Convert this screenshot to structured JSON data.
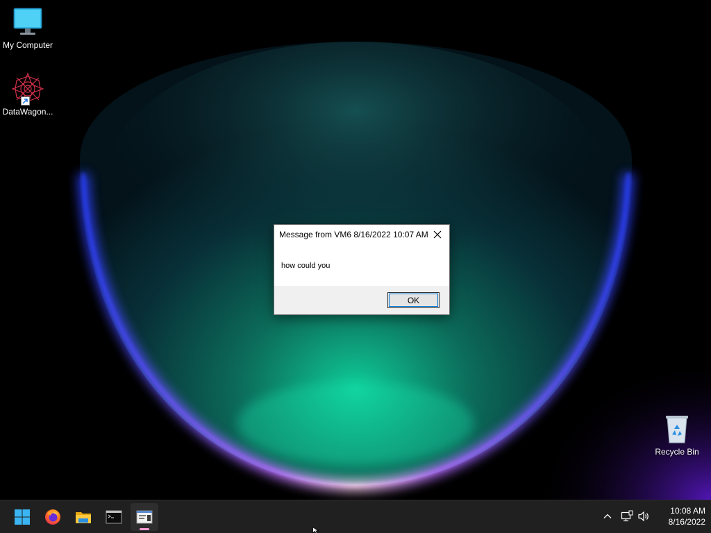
{
  "desktop": {
    "icons": [
      {
        "label": "My Computer",
        "icon": "monitor-icon"
      },
      {
        "label": "DataWagon...",
        "icon": "datawagon-icon"
      },
      {
        "label": "Recycle Bin",
        "icon": "recycle-bin-icon"
      }
    ]
  },
  "dialog": {
    "title": "Message from VM6 8/16/2022 10:07 AM",
    "message": "how could you",
    "ok_label": "OK",
    "close_icon": "close-icon"
  },
  "taskbar": {
    "apps": [
      {
        "name": "Start",
        "icon": "windows-start-icon"
      },
      {
        "name": "Firefox",
        "icon": "firefox-icon"
      },
      {
        "name": "File Explorer",
        "icon": "folder-icon"
      },
      {
        "name": "Command Prompt",
        "icon": "terminal-icon"
      },
      {
        "name": "Message window",
        "icon": "app-window-icon",
        "active": true
      }
    ],
    "tray": {
      "icons": [
        "chevron-up-icon",
        "network-icon",
        "volume-icon"
      ],
      "time": "10:08 AM",
      "date": "8/16/2022"
    }
  },
  "colors": {
    "taskbar_bg": "#202020",
    "accent": "#0078d7",
    "active_indicator": "#ff9ad5"
  }
}
